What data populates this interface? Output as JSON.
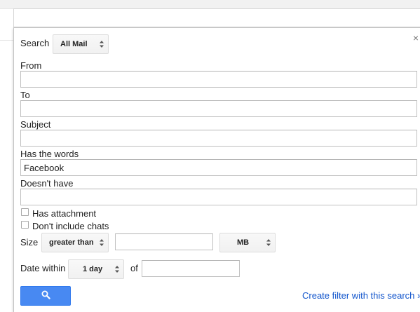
{
  "search": {
    "label": "Search",
    "scope_value": "All Mail"
  },
  "fields": {
    "from_label": "From",
    "from_value": "",
    "to_label": "To",
    "to_value": "",
    "subject_label": "Subject",
    "subject_value": "",
    "has_words_label": "Has the words",
    "has_words_value": "Facebook",
    "doesnt_have_label": "Doesn't have",
    "doesnt_have_value": ""
  },
  "options": {
    "has_attachment_label": "Has attachment",
    "has_attachment_checked": false,
    "no_chats_label": "Don't include chats",
    "no_chats_checked": false
  },
  "size": {
    "label": "Size",
    "comparator": "greater than",
    "value": "",
    "unit": "MB"
  },
  "date": {
    "label": "Date within",
    "range": "1 day",
    "of_label": "of",
    "of_value": ""
  },
  "actions": {
    "close_glyph": "×",
    "search_button_icon": "search-icon",
    "create_filter_label": "Create filter with this search »"
  },
  "colors": {
    "primary_button": "#4889f2",
    "link": "#1155cc"
  }
}
